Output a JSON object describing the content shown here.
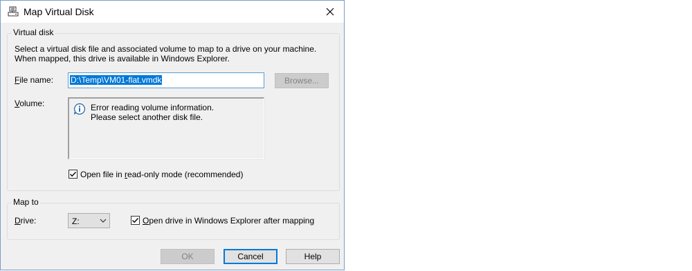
{
  "window": {
    "title": "Map Virtual Disk"
  },
  "virtual_disk": {
    "group_label": "Virtual disk",
    "description_line1": "Select a virtual disk file and associated volume to map to a drive on your machine.",
    "description_line2": "When mapped, this drive is available in Windows Explorer.",
    "file_name_label_key": "F",
    "file_name_label_rest": "ile name:",
    "file_name_value": "D:\\Temp\\VM01-flat.vmdk",
    "browse_label": "Browse...",
    "volume_label_key": "V",
    "volume_label_rest": "olume:",
    "volume_message_line1": "Error reading volume information.",
    "volume_message_line2": "Please select another disk file.",
    "readonly_label_pre": "Open file in ",
    "readonly_label_key": "r",
    "readonly_label_post": "ead-only mode (recommended)",
    "readonly_checked": true
  },
  "map_to": {
    "group_label": "Map to",
    "drive_label_key": "D",
    "drive_label_rest": "rive:",
    "drive_value": "Z:",
    "open_explorer_label_key": "O",
    "open_explorer_label_rest": "pen drive in Windows Explorer after mapping",
    "open_explorer_checked": true
  },
  "buttons": {
    "ok": "OK",
    "cancel": "Cancel",
    "help": "Help"
  },
  "icons": {
    "title": "map-disk-icon",
    "close": "close-icon",
    "info": "info-icon",
    "dropdown": "chevron-down-icon",
    "check": "check-icon"
  },
  "colors": {
    "selection": "#0078d7",
    "focus_border": "#5b9bd5",
    "dialog_bg": "#f0f0f0"
  }
}
